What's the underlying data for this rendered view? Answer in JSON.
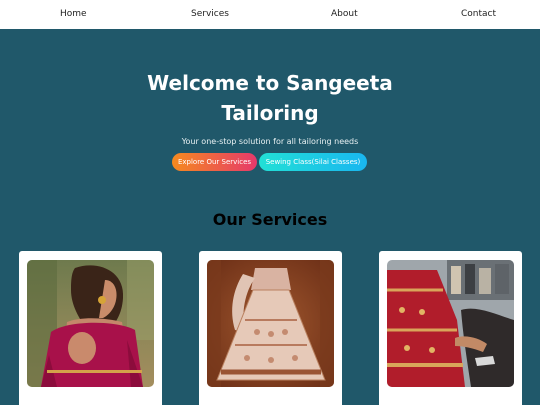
{
  "nav": {
    "home": "Home",
    "services": "Services",
    "about": "About",
    "contact": "Contact"
  },
  "hero": {
    "title": "Welcome to Sangeeta Tailoring",
    "subtitle": "Your one-stop solution for all tailoring needs",
    "explore_button": "Explore Our Services",
    "sewing_button": "Sewing Class(Silai Classes)"
  },
  "services": {
    "heading": "Our Services"
  },
  "colors": {
    "hero_bg": "#20586a",
    "explore_gradient": [
      "#f58a1f",
      "#e6396b"
    ],
    "sewing_gradient": [
      "#22e0d6",
      "#19b6f0"
    ]
  }
}
